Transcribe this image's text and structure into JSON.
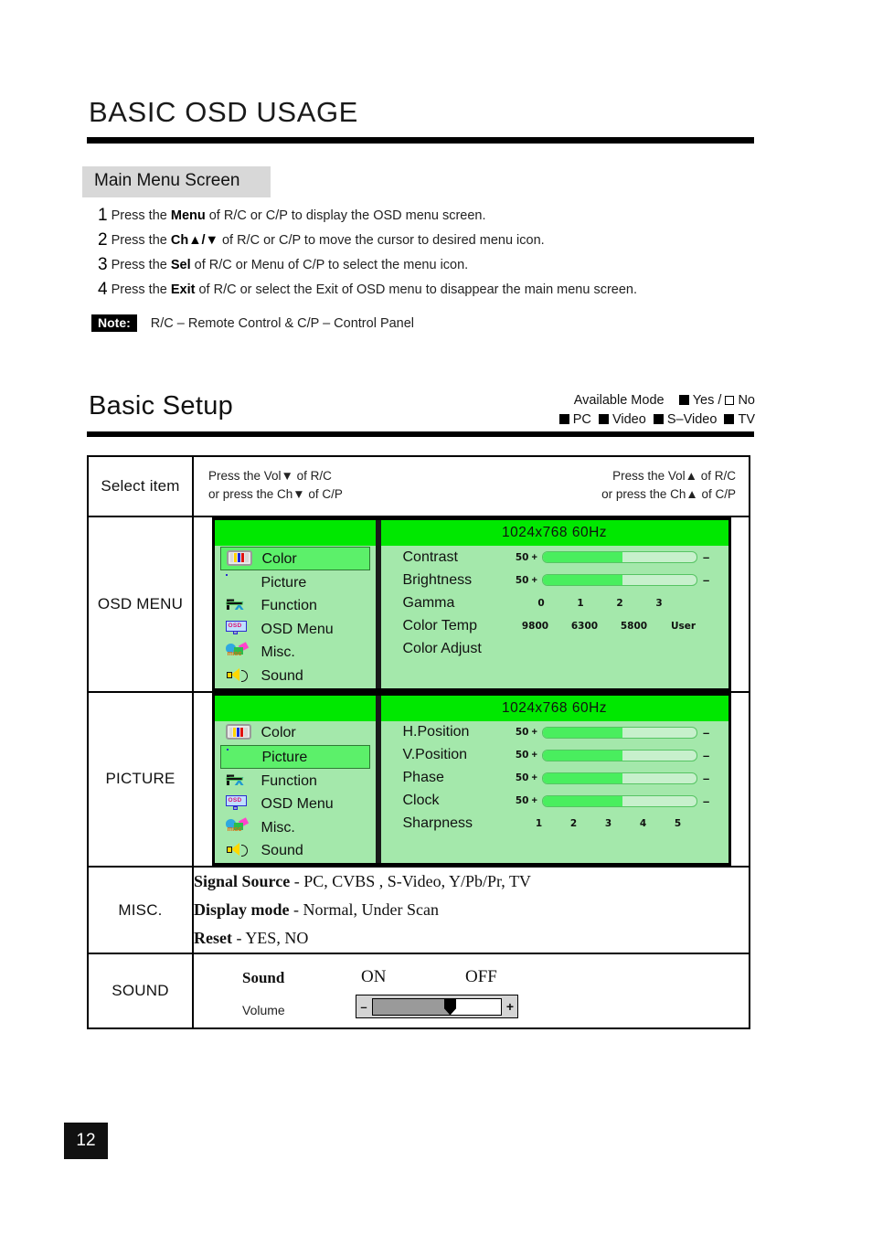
{
  "document": {
    "title": "BASIC OSD USAGE",
    "page_number": "12"
  },
  "section": {
    "heading": "Main Menu Screen",
    "steps": [
      {
        "num": "1",
        "pre": "Press the ",
        "key": "Menu",
        "post": " of R/C or C/P to display the OSD menu screen."
      },
      {
        "num": "2",
        "pre": "Press the ",
        "key": "Ch▲/▼",
        "post": " of R/C or C/P to move the cursor to desired menu icon."
      },
      {
        "num": "3",
        "pre": "Press the ",
        "key": "Sel",
        "post": " of R/C or  Menu of C/P to select the menu icon."
      },
      {
        "num": "4",
        "pre": "Press the ",
        "key": "Exit",
        "post": " of R/C or select the Exit of OSD menu to disappear the main menu screen."
      }
    ],
    "note_badge": "Note:",
    "note_text": "R/C – Remote Control & C/P – Control Panel"
  },
  "setup": {
    "title": "Basic Setup",
    "available_mode_label": "Available Mode",
    "yes_label": "Yes",
    "no_label": "No",
    "slash": "/",
    "modes": [
      "PC",
      "Video",
      "S–Video",
      "TV"
    ]
  },
  "table": {
    "select_item_label": "Select item",
    "select_left_line1": "Press the Vol▼ of R/C",
    "select_left_line2": "or press the Ch▼ of C/P",
    "select_right_line1": "Press the Vol▲ of R/C",
    "select_right_line2": "or press the Ch▲ of C/P",
    "rows": {
      "osd_menu": {
        "label": "OSD MENU",
        "resolution": "1024x768   60Hz",
        "menu_items": [
          "Color",
          "Picture",
          "Function",
          "OSD Menu",
          "Misc.",
          "Sound"
        ],
        "selected_item": "Color",
        "settings": [
          {
            "name": "Contrast",
            "type": "slider",
            "value": "50",
            "plus": "+",
            "minus": "–",
            "fill_pct": 52
          },
          {
            "name": "Brightness",
            "type": "slider",
            "value": "50",
            "plus": "+",
            "minus": "–",
            "fill_pct": 52
          },
          {
            "name": "Gamma",
            "type": "ticks",
            "options": [
              "0",
              "1",
              "2",
              "3"
            ]
          },
          {
            "name": "Color Temp",
            "type": "ticks",
            "options": [
              "9800",
              "6300",
              "5800",
              "User"
            ]
          },
          {
            "name": "Color Adjust",
            "type": "plain",
            "options": []
          }
        ]
      },
      "picture": {
        "label": "PICTURE",
        "resolution": "1024x768   60Hz",
        "menu_items": [
          "Color",
          "Picture",
          "Function",
          "OSD Menu",
          "Misc.",
          "Sound"
        ],
        "selected_item": "Picture",
        "settings": [
          {
            "name": "H.Position",
            "type": "slider",
            "value": "50",
            "plus": "+",
            "minus": "–",
            "fill_pct": 52
          },
          {
            "name": "V.Position",
            "type": "slider",
            "value": "50",
            "plus": "+",
            "minus": "–",
            "fill_pct": 52
          },
          {
            "name": "Phase",
            "type": "slider",
            "value": "50",
            "plus": "+",
            "minus": "–",
            "fill_pct": 52
          },
          {
            "name": "Clock",
            "type": "slider",
            "value": "50",
            "plus": "+",
            "minus": "–",
            "fill_pct": 52
          },
          {
            "name": "Sharpness",
            "type": "ticks",
            "options": [
              "1",
              "2",
              "3",
              "4",
              "5"
            ]
          }
        ]
      },
      "misc": {
        "label": "MISC.",
        "lines": [
          {
            "key": "Signal Source",
            "sep": " - ",
            "value": "PC, CVBS , S-Video, Y/Pb/Pr, TV"
          },
          {
            "key": "Display mode",
            "sep": " - ",
            "value": "Normal,  Under Scan"
          },
          {
            "key": "Reset",
            "sep": " - ",
            "value": " YES,  NO"
          }
        ]
      },
      "sound": {
        "label": "SOUND",
        "sound_label": "Sound",
        "on_label": "ON",
        "off_label": "OFF",
        "volume_label": "Volume",
        "volume_minus": "–",
        "volume_plus": "+",
        "volume_pct": 60
      }
    }
  },
  "colors": {
    "osd_header_green": "#00e800",
    "osd_body_green": "#a4e8ab",
    "osd_selected_green": "#5cf06a",
    "bar_fill": "#49ee5e",
    "bar_track": "#c7f0cc",
    "chip_gray": "#d8d8d8",
    "volume_fill": "#9a9a9a"
  }
}
